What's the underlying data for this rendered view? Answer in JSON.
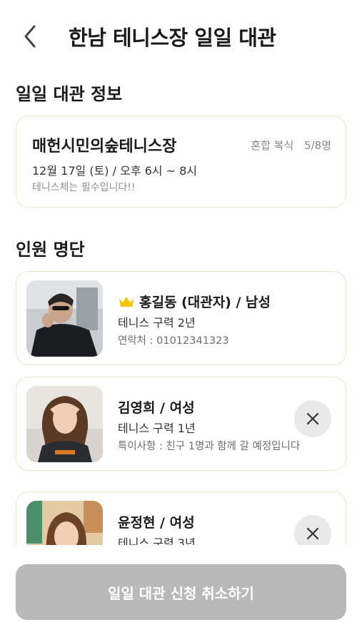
{
  "header": {
    "back_icon": "chevron-left-icon",
    "title": "한남 테니스장 일일 대관"
  },
  "booking_info": {
    "section_title": "일일 대관 정보",
    "court_name": "매헌시민의숲테니스장",
    "match_type": "혼합 복식",
    "capacity": "5/8명",
    "datetime": "12월 17일 (토) / 오후 6시 ~ 8시",
    "notice": "테니스체는 필수입니다!!"
  },
  "roster": {
    "section_title": "인원 명단",
    "members": [
      {
        "is_host": true,
        "host_icon": "crown-icon",
        "name": "홍길동 (대관자) / 남성",
        "career": "테니스 구력 2년",
        "extra": "연락처 :  01012341323",
        "removable": false
      },
      {
        "is_host": false,
        "name": "김영희 / 여성",
        "career": "테니스 구력 1년",
        "extra": "특이사항 : 친구 1명과 함께 갈 예정입니다",
        "removable": true,
        "remove_icon": "close-icon"
      },
      {
        "is_host": false,
        "name": "윤정현 / 여성",
        "career": "테니스 구력 3년",
        "extra": "",
        "removable": true,
        "remove_icon": "close-icon"
      }
    ]
  },
  "footer": {
    "cancel_label": "일일 대관 신청 취소하기"
  },
  "colors": {
    "card_border": "#ece6cf",
    "crown": "#f5c400",
    "button_disabled": "#b9b9b9"
  }
}
